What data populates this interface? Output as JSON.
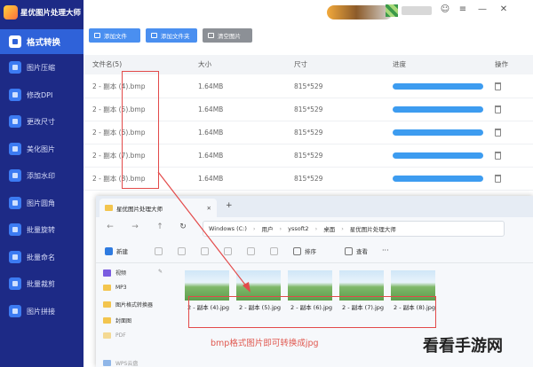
{
  "app": {
    "title": "星优图片处理大师"
  },
  "sidebar": {
    "items": [
      {
        "label": "格式转换",
        "active": true
      },
      {
        "label": "图片压缩"
      },
      {
        "label": "修改DPI"
      },
      {
        "label": "更改尺寸"
      },
      {
        "label": "美化图片"
      },
      {
        "label": "添加水印"
      },
      {
        "label": "图片圆角"
      },
      {
        "label": "批量旋转"
      },
      {
        "label": "批量命名"
      },
      {
        "label": "批量裁剪"
      },
      {
        "label": "图片拼接"
      }
    ]
  },
  "titlebar": {
    "controls": [
      "☺",
      "≡",
      "—",
      "✕"
    ]
  },
  "toolbar": {
    "add_file": "添加文件",
    "add_folder": "添加文件夹",
    "clear": "清空图片"
  },
  "table": {
    "columns": [
      "文件名(5)",
      "大小",
      "尺寸",
      "进度",
      "操作"
    ],
    "rows": [
      {
        "name": "2 - 副本 (4).bmp",
        "size": "1.64MB",
        "dims": "815*529",
        "progress": 1
      },
      {
        "name": "2 - 副本 (5).bmp",
        "size": "1.64MB",
        "dims": "815*529",
        "progress": 1
      },
      {
        "name": "2 - 副本 (6).bmp",
        "size": "1.64MB",
        "dims": "815*529",
        "progress": 1
      },
      {
        "name": "2 - 副本 (7).bmp",
        "size": "1.64MB",
        "dims": "815*529",
        "progress": 1
      },
      {
        "name": "2 - 副本 (8).bmp",
        "size": "1.64MB",
        "dims": "815*529",
        "progress": 1
      }
    ]
  },
  "explorer": {
    "tab_title": "星优图片处理大师",
    "tab_close": "✕",
    "tab_add": "+",
    "nav": [
      "←",
      "→",
      "↑",
      "↻"
    ],
    "address": [
      "Windows (C:)",
      "用户",
      "yssoft2",
      "桌面",
      "星优图片处理大师"
    ],
    "commands": {
      "new": "新建",
      "sort": "排序",
      "view": "查看",
      "more": "···"
    },
    "nav_items": [
      "视频",
      "MP3",
      "图片格式转换器",
      "封面图",
      "PDF",
      "WPS云盘"
    ],
    "files": [
      "2 - 副本 (4).jpg",
      "2 - 副本 (5).jpg",
      "2 - 副本 (6).jpg",
      "2 - 副本 (7).jpg",
      "2 - 副本 (8).jpg"
    ]
  },
  "annotation": {
    "caption": "bmp格式图片即可转换成jpg"
  },
  "watermark": "看看手游网",
  "colors": {
    "sidebar": "#1d2a86",
    "active": "#2f62d9",
    "primary": "#3d8ff5",
    "annotation": "#e34a4a"
  }
}
